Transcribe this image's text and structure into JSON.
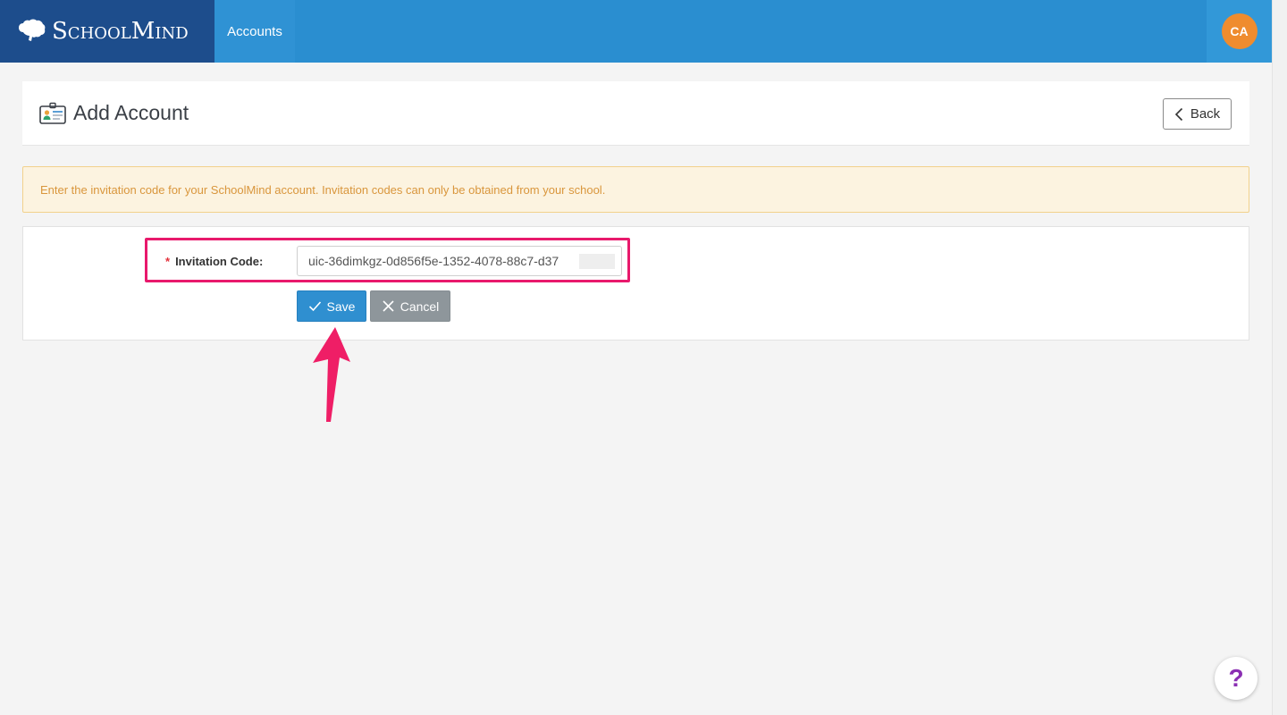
{
  "header": {
    "brand_name": "SchoolMind",
    "nav_accounts": "Accounts",
    "avatar_initials": "CA"
  },
  "page": {
    "title": "Add Account",
    "back_label": "Back"
  },
  "alert": {
    "text": "Enter the invitation code for your SchoolMind account. Invitation codes can only be obtained from your school."
  },
  "form": {
    "required_marker": "*",
    "invitation_label": "Invitation Code:",
    "invitation_value": "uic-36dimkgz-0d856f5e-1352-4078-88c7-d37",
    "save_label": "Save",
    "cancel_label": "Cancel"
  },
  "help": {
    "label": "?"
  },
  "colors": {
    "brand_dark": "#1d4d8c",
    "topbar": "#2a8ed0",
    "avatar": "#ef8c2e",
    "highlight": "#e8196c",
    "save": "#2f8fd0",
    "cancel": "#8e969b",
    "alert_text": "#d9963c"
  },
  "icons": {
    "brand": "brain-icon",
    "page": "id-card-icon",
    "back": "chevron-left-icon",
    "save": "check-icon",
    "cancel": "close-icon",
    "help": "question-icon"
  }
}
